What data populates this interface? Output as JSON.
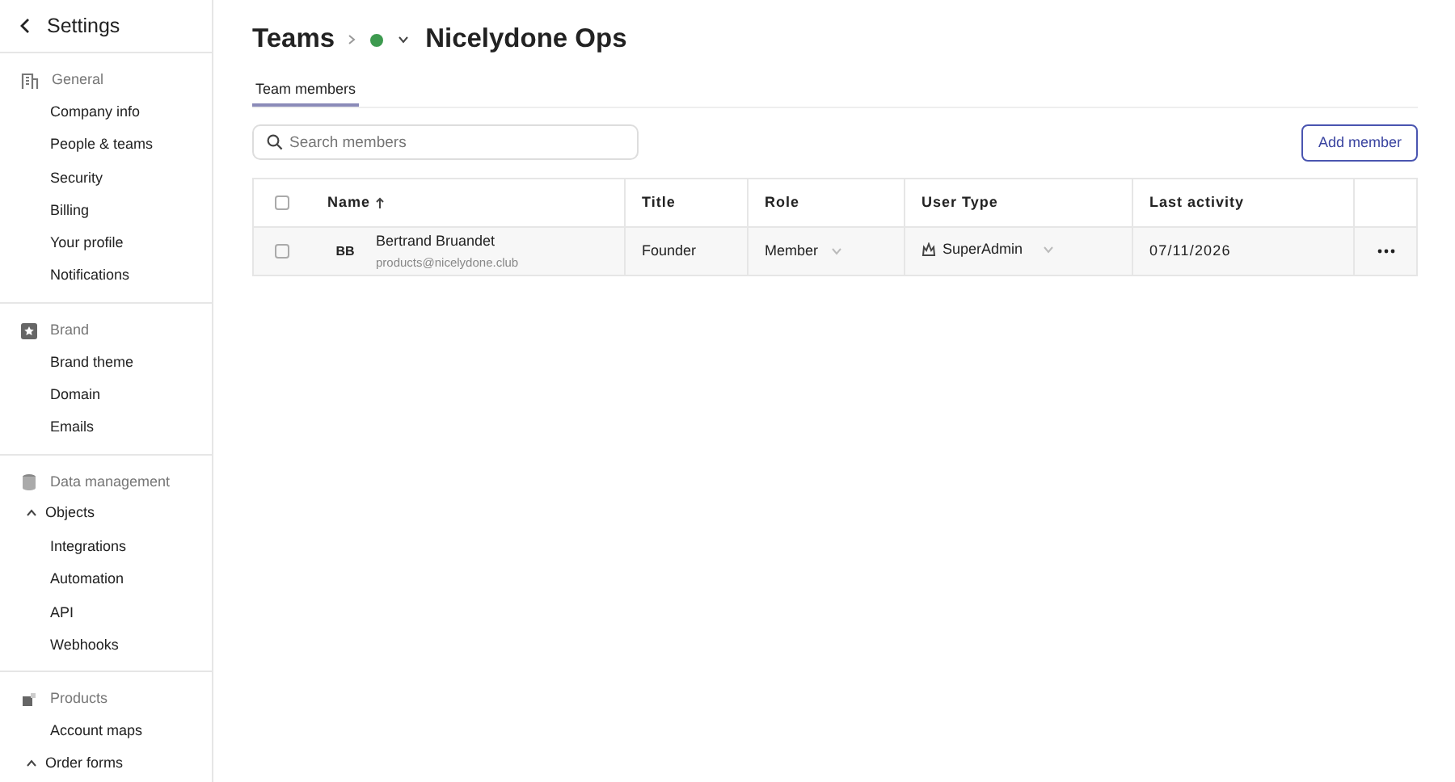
{
  "sidebar": {
    "title": "Settings",
    "sections": [
      {
        "heading": "General",
        "items": [
          {
            "label": "Company info",
            "kind": "link"
          },
          {
            "label": "People & teams",
            "kind": "link"
          },
          {
            "label": "Security",
            "kind": "link"
          },
          {
            "label": "Billing",
            "kind": "link"
          },
          {
            "label": "Your profile",
            "kind": "link"
          },
          {
            "label": "Notifications",
            "kind": "link"
          }
        ]
      },
      {
        "heading": "Brand",
        "items": [
          {
            "label": "Brand theme",
            "kind": "link"
          },
          {
            "label": "Domain",
            "kind": "link"
          },
          {
            "label": "Emails",
            "kind": "link"
          }
        ]
      },
      {
        "heading": "Data management",
        "items": [
          {
            "label": "Objects",
            "kind": "group",
            "expanded": true
          },
          {
            "label": "Integrations",
            "kind": "link"
          },
          {
            "label": "Automation",
            "kind": "link"
          },
          {
            "label": "API",
            "kind": "link"
          },
          {
            "label": "Webhooks",
            "kind": "link"
          }
        ]
      },
      {
        "heading": "Products",
        "items": [
          {
            "label": "Account maps",
            "kind": "link"
          },
          {
            "label": "Order forms",
            "kind": "group",
            "expanded": true
          }
        ]
      }
    ]
  },
  "breadcrumb": {
    "parent": "Teams",
    "team": "Nicelydone Ops"
  },
  "tabs": [
    {
      "label": "Team members",
      "selected": true
    }
  ],
  "search": {
    "placeholder": "Search members"
  },
  "add_button": "Add member",
  "table": {
    "all_checked": false,
    "columns": [
      "Name",
      "Title",
      "Role",
      "User Type",
      "Last activity"
    ],
    "rows": [
      {
        "checked": false,
        "initials": "BB",
        "name": "Bertrand Bruandet",
        "email": "products@nicelydone.club",
        "title": "Founder",
        "role": "Member",
        "user_type": "SuperAdmin",
        "last_activity": "07/11/2026"
      }
    ]
  }
}
